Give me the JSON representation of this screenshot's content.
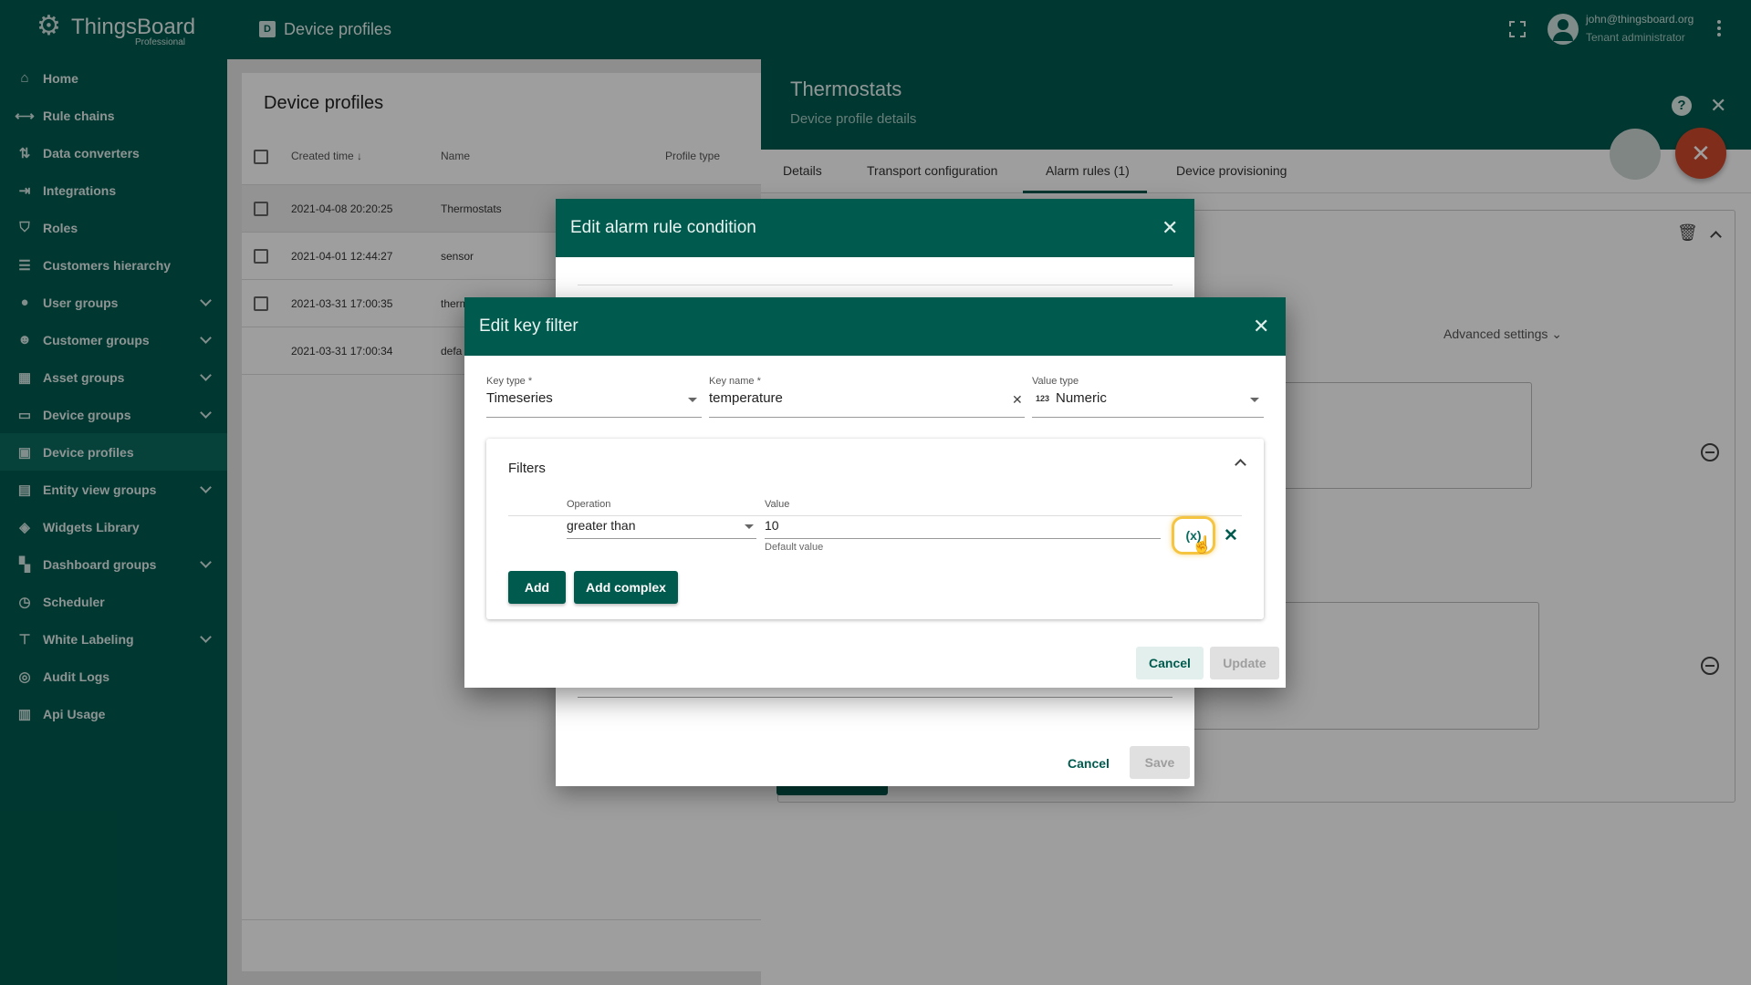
{
  "app": {
    "logo_text": "ThingsBoard",
    "logo_sub": "Professional"
  },
  "sidebar": {
    "items": [
      {
        "label": "Home",
        "icon": "home-icon"
      },
      {
        "label": "Rule chains",
        "icon": "rule-chain-icon"
      },
      {
        "label": "Data converters",
        "icon": "converter-icon"
      },
      {
        "label": "Integrations",
        "icon": "integration-icon"
      },
      {
        "label": "Roles",
        "icon": "shield-icon"
      },
      {
        "label": "Customers hierarchy",
        "icon": "hierarchy-icon"
      },
      {
        "label": "User groups",
        "icon": "account-icon"
      },
      {
        "label": "Customer groups",
        "icon": "people-icon"
      },
      {
        "label": "Asset groups",
        "icon": "domain-icon"
      },
      {
        "label": "Device groups",
        "icon": "devices-icon"
      },
      {
        "label": "Device profiles",
        "icon": "device-profile-icon"
      },
      {
        "label": "Entity view groups",
        "icon": "view-quilt-icon"
      },
      {
        "label": "Widgets Library",
        "icon": "widgets-icon"
      },
      {
        "label": "Dashboard groups",
        "icon": "dashboard-icon"
      },
      {
        "label": "Scheduler",
        "icon": "clock-icon"
      },
      {
        "label": "White Labeling",
        "icon": "paint-roller-icon"
      },
      {
        "label": "Audit Logs",
        "icon": "track-changes-icon"
      },
      {
        "label": "Api Usage",
        "icon": "insert-chart-icon"
      }
    ]
  },
  "topbar": {
    "title": "Device profiles",
    "user_email": "john@thingsboard.org",
    "user_role": "Tenant administrator"
  },
  "list": {
    "title": "Device profiles",
    "headers": {
      "created": "Created time",
      "name": "Name",
      "type": "Profile type"
    },
    "rows": [
      {
        "created": "2021-04-08 20:20:25",
        "name": "Thermostats"
      },
      {
        "created": "2021-04-01 12:44:27",
        "name": "sensor"
      },
      {
        "created": "2021-03-31 17:00:35",
        "name": "therm"
      },
      {
        "created": "2021-03-31 17:00:34",
        "name": "defa"
      }
    ]
  },
  "detail": {
    "title": "Thermostats",
    "subtitle": "Device profile details",
    "tabs": [
      "Details",
      "Transport configuration",
      "Alarm rules (1)",
      "Device provisioning"
    ],
    "advanced_settings": "Advanced settings"
  },
  "alarm_dialog": {
    "title": "Edit alarm rule condition",
    "cancel": "Cancel",
    "save": "Save"
  },
  "key_filter_dialog": {
    "title": "Edit key filter",
    "key_type_label": "Key type *",
    "key_type_value": "Timeseries",
    "key_name_label": "Key name *",
    "key_name_value": "temperature",
    "value_type_label": "Value type",
    "value_type_prefix": "123",
    "value_type_value": "Numeric",
    "filters_title": "Filters",
    "operation_label": "Operation",
    "operation_value": "greater than",
    "value_label": "Value",
    "value_value": "10",
    "value_hint": "Default value",
    "dynamic_button": "(x)",
    "add": "Add",
    "add_complex": "Add complex",
    "cancel": "Cancel",
    "update": "Update"
  },
  "colors": {
    "primary": "#005a4e",
    "accent_red": "#d04a2e",
    "highlight": "#f5c542"
  }
}
